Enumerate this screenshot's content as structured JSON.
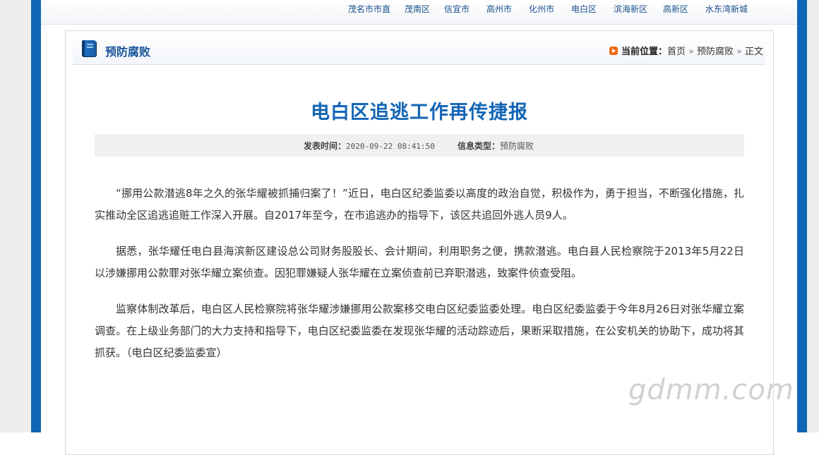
{
  "nav": {
    "items": [
      "茂名市市直",
      "茂南区",
      "信宜市",
      "高州市",
      "化州市",
      "电白区",
      "滨海新区",
      "高新区",
      "水东湾新城"
    ]
  },
  "section": {
    "title": "预防腐败",
    "breadcrumb": {
      "label": "当前位置：",
      "items": [
        "首页",
        "预防腐败",
        "正文"
      ],
      "separator": "»"
    }
  },
  "article": {
    "title": "电白区追逃工作再传捷报",
    "meta": {
      "published_label": "发表时间：",
      "published_value": "2020-09-22 08:41:50",
      "type_label": "信息类型：",
      "type_value": "预防腐败"
    },
    "paragraphs": [
      "“挪用公款潜逃8年之久的张华耀被抓捕归案了！”近日，电白区纪委监委以高度的政治自觉，积极作为，勇于担当，不断强化措施，扎实推动全区追逃追赃工作深入开展。自2017年至今，在市追逃办的指导下，该区共追回外逃人员9人。",
      "据悉，张华耀任电白县海滨新区建设总公司财务股股长、会计期间，利用职务之便，携款潜逃。电白县人民检察院于2013年5月22日以涉嫌挪用公款罪对张华耀立案侦查。因犯罪嫌疑人张华耀在立案侦查前已弃职潜逃，致案件侦查受阻。",
      "监察体制改革后，电白区人民检察院将张华耀涉嫌挪用公款案移交电白区纪委监委处理。电白区纪委监委于今年8月26日对张华耀立案调查。在上级业务部门的大力支持和指导下，电白区纪委监委在发现张华耀的活动踪迹后，果断采取措施，在公安机关的协助下，成功将其抓获。（电白区纪委监委宣）"
    ]
  },
  "watermark": "gdmm.com",
  "colors": {
    "border_blue": "#0f66b6",
    "title_blue": "#1466b5",
    "section_blue": "#16549a",
    "breadcrumb_icon": "#f06a13"
  },
  "icons": {
    "section": "book-icon",
    "breadcrumb": "play-arrow-icon"
  }
}
